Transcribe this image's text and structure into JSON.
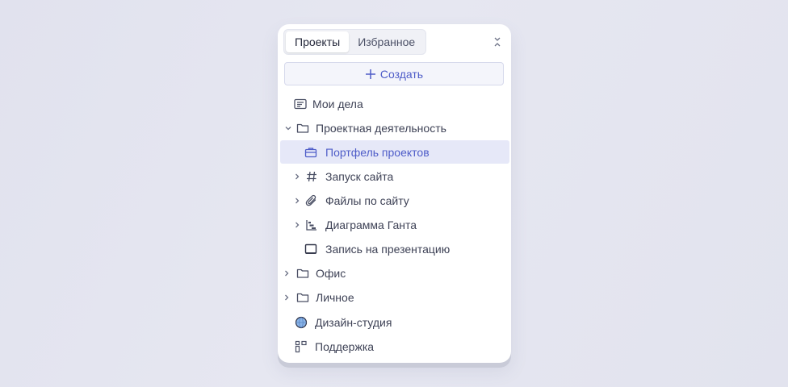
{
  "tabs": [
    {
      "label": "Проекты",
      "active": true
    },
    {
      "label": "Избранное",
      "active": false
    }
  ],
  "create_button": {
    "label": "Создать"
  },
  "tree": [
    {
      "label": "Мои дела",
      "icon": "task-list-icon",
      "level": 0,
      "chevron": "none"
    },
    {
      "label": "Проектная деятельность",
      "icon": "folder-icon",
      "level": 0,
      "chevron": "expanded"
    },
    {
      "label": "Портфель проектов",
      "icon": "briefcase-icon",
      "level": 1,
      "chevron": "none",
      "selected": true
    },
    {
      "label": "Запуск сайта",
      "icon": "hash-icon",
      "level": 1,
      "chevron": "collapsed"
    },
    {
      "label": "Файлы по сайту",
      "icon": "paperclip-icon",
      "level": 1,
      "chevron": "collapsed"
    },
    {
      "label": "Диаграмма Ганта",
      "icon": "gantt-icon",
      "level": 1,
      "chevron": "collapsed"
    },
    {
      "label": "Запись на презентацию",
      "icon": "board-icon",
      "level": 1,
      "chevron": "none"
    },
    {
      "label": "Офис",
      "icon": "folder-icon",
      "level": 0,
      "chevron": "collapsed"
    },
    {
      "label": "Личное",
      "icon": "folder-icon",
      "level": 0,
      "chevron": "collapsed"
    },
    {
      "label": "Дизайн-студия",
      "icon": "globe-icon",
      "level": 0,
      "chevron": "none"
    },
    {
      "label": "Поддержка",
      "icon": "support-icon",
      "level": 0,
      "chevron": "none"
    }
  ],
  "colors": {
    "accent": "#4e5cc8",
    "selected_bg": "#e6e8f8"
  }
}
